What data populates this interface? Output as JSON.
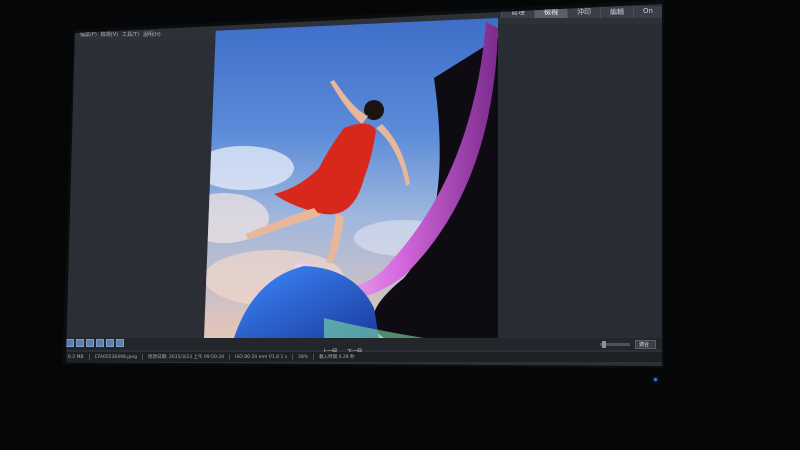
{
  "mode_tabs": [
    {
      "label": "管理",
      "active": false
    },
    {
      "label": "檢視",
      "active": true
    },
    {
      "label": "沖印",
      "active": false
    },
    {
      "label": "編輯",
      "active": false
    },
    {
      "label": "On",
      "active": false
    }
  ],
  "menu": {
    "items": [
      "檔案(F)",
      "檢視(V)",
      "工具(T)",
      "說明(H)"
    ]
  },
  "toolbar": {
    "prev_label": "上一個",
    "next_label": "下一個",
    "zoom_value": "適合"
  },
  "status": {
    "file_size": "6.2 MB",
    "file_name": "CFA05536498.jpeg",
    "modified": "修改日期: 2015/3/23 上午 09:50:34",
    "exposure": "ISO 80  24 mm  f/1.8  1 s",
    "zoom_percent": "28%",
    "load_time": "載入時間 0.28 秒"
  },
  "colors": {
    "accent": "#5d7fb0",
    "background": "#2c3037",
    "led": "#3a7bff"
  }
}
